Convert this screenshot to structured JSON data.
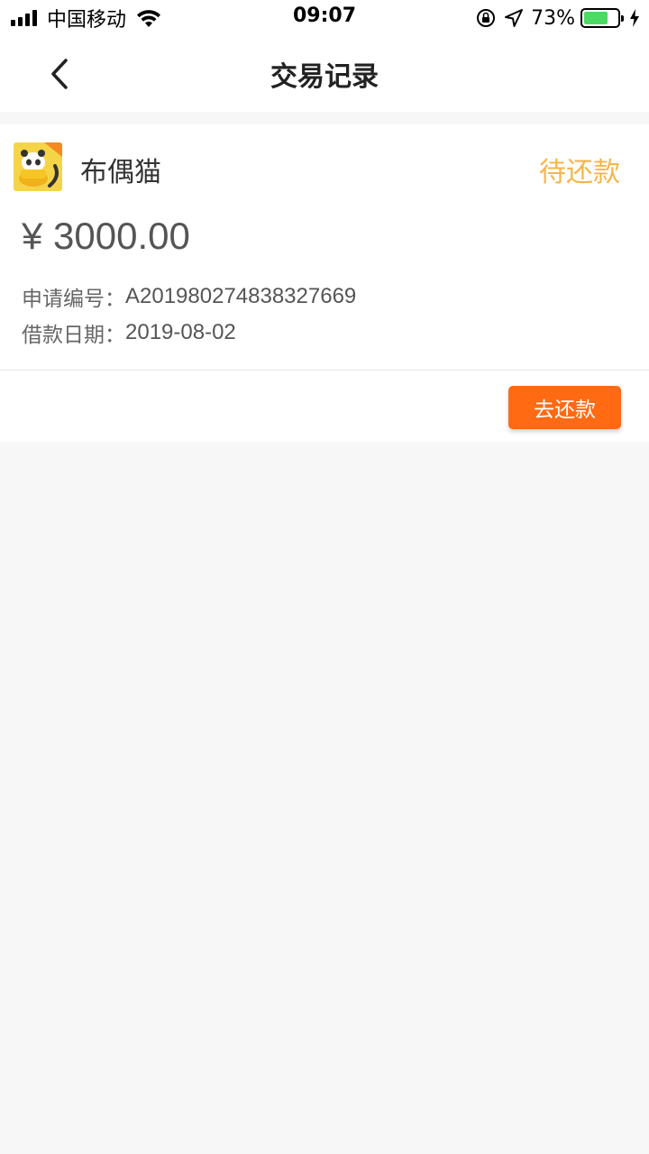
{
  "status_bar": {
    "carrier": "中国移动",
    "time": "09:07",
    "battery_percent": "73%",
    "battery_level": 0.73
  },
  "nav": {
    "title": "交易记录",
    "back_icon": "chevron-left-icon"
  },
  "record": {
    "app_name": "布偶猫",
    "status": "待还款",
    "amount": "¥ 3000.00",
    "application_no_label": "申请编号：",
    "application_no": "A201980274838327669",
    "loan_date_label": "借款日期：",
    "loan_date": "2019-08-02",
    "repay_button": "去还款"
  },
  "colors": {
    "status_text": "#f6b54a",
    "button_bg": "#ff6a13",
    "battery_fill": "#4cd964"
  }
}
